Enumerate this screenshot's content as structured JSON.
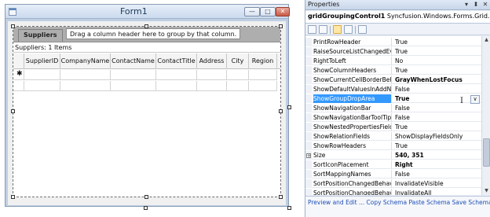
{
  "form": {
    "title": "Form1",
    "minimize_glyph": "—",
    "maximize_glyph": "□",
    "close_glyph": "✕"
  },
  "grid": {
    "group_tab_label": "Suppliers",
    "group_hint": "Drag a column header here to group by that column.",
    "items_count": "Suppliers: 1 Items",
    "columns": [
      "SupplierID",
      "CompanyName",
      "ContactName",
      "ContactTitle",
      "Address",
      "City",
      "Region"
    ],
    "new_row_marker": "✱"
  },
  "properties": {
    "title": "Properties",
    "pin_glyph": "▾",
    "autohide_glyph": "⬍",
    "close_glyph": "✕",
    "object_name": "gridGroupingControl1",
    "object_type": "Syncfusion.Windows.Forms.Grid.Groupin",
    "rows": [
      {
        "name": "PrintRowHeader",
        "value": "True",
        "bold": false
      },
      {
        "name": "RaiseSourceListChangedEvent",
        "value": "True",
        "bold": false
      },
      {
        "name": "RightToLeft",
        "value": "No",
        "bold": false
      },
      {
        "name": "ShowColumnHeaders",
        "value": "True",
        "bold": false
      },
      {
        "name": "ShowCurrentCellBorderBehav",
        "value": "GrayWhenLostFocus",
        "bold": true
      },
      {
        "name": "ShowDefaultValuesInAddNew",
        "value": "False",
        "bold": false
      },
      {
        "name": "ShowGroupDropArea",
        "value": "True",
        "bold": true
      },
      {
        "name": "ShowNavigationBar",
        "value": "False",
        "bold": false
      },
      {
        "name": "ShowNavigationBarToolTips",
        "value": "False",
        "bold": false
      },
      {
        "name": "ShowNestedPropertiesFields",
        "value": "True",
        "bold": false
      },
      {
        "name": "ShowRelationFields",
        "value": "ShowDisplayFieldsOnly",
        "bold": false
      },
      {
        "name": "ShowRowHeaders",
        "value": "True",
        "bold": false
      },
      {
        "name": "Size",
        "value": "540, 351",
        "bold": true
      },
      {
        "name": "SortIconPlacement",
        "value": "Right",
        "bold": true
      },
      {
        "name": "SortMappingNames",
        "value": "False",
        "bold": false
      },
      {
        "name": "SortPositionChangedBehavior",
        "value": "InvalidateVisible",
        "bold": false
      },
      {
        "name": "SortPositionChangedBehavior",
        "value": "InvalidateAll",
        "bold": false
      }
    ],
    "selected_row": "ShowGroupDropArea",
    "dropdown_glyph": "∨",
    "cursor_glyph": "I",
    "expand_glyph": "+",
    "links": "Preview and Edit ...  Copy Schema  Paste Schema  Save Schema ..."
  }
}
